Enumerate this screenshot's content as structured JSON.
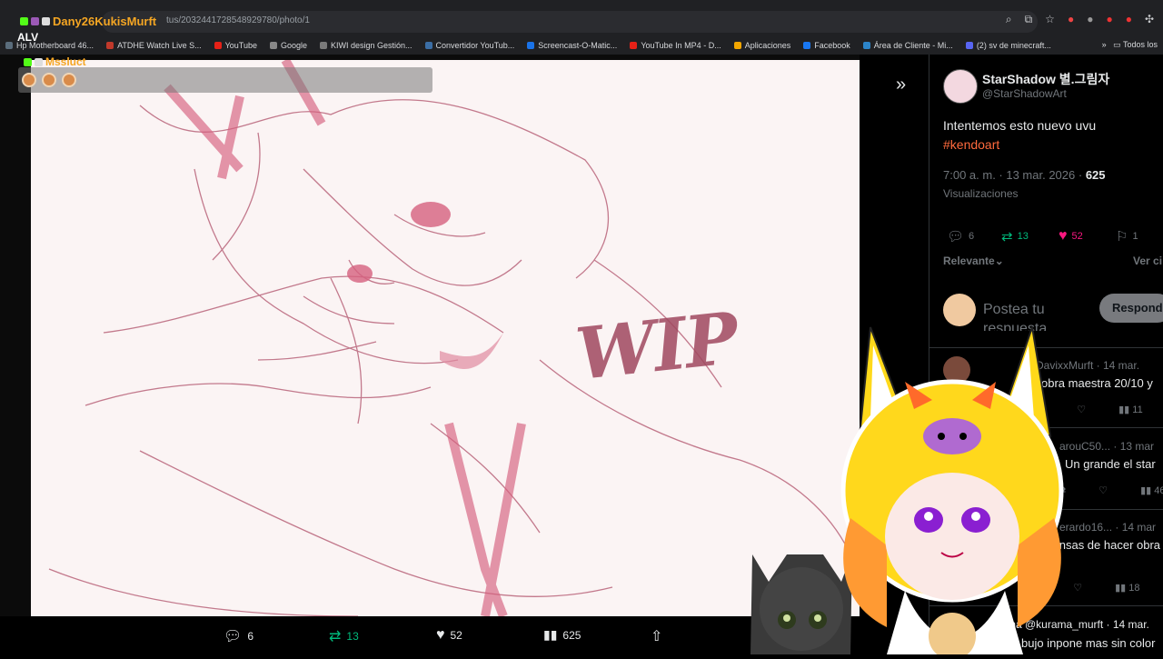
{
  "browser": {
    "url": "tus/2032441728548929780/photo/1",
    "bookmarks": [
      {
        "label": "Hp Motherboard 46...",
        "color": "#5a6d7c"
      },
      {
        "label": "ATDHE Watch Live S...",
        "color": "#c0392b"
      },
      {
        "label": "YouTube",
        "color": "#e62117"
      },
      {
        "label": "Google",
        "color": "#888888"
      },
      {
        "label": "KIWI design Gestión...",
        "color": "#7a7a7a"
      },
      {
        "label": "Convertidor YouTub...",
        "color": "#3b6ea5"
      },
      {
        "label": "Screencast-O-Matic...",
        "color": "#1a73e8"
      },
      {
        "label": "YouTube In MP4 - D...",
        "color": "#e62117"
      },
      {
        "label": "Aplicaciones",
        "color": "#f2a600"
      },
      {
        "label": "Facebook",
        "color": "#1877f2"
      },
      {
        "label": "Área de Cliente - Mi...",
        "color": "#2c84c8"
      },
      {
        "label": "(2) sv de minecraft...",
        "color": "#5865f2"
      }
    ],
    "bookmarks_more": "»",
    "bookmarks_all": "Todos los"
  },
  "chat": {
    "user1": "Dany26KukisMurft",
    "message1": "ALV",
    "user2": "Mssluct"
  },
  "action_bar": {
    "replies": "6",
    "reposts": "13",
    "likes": "52",
    "views": "625"
  },
  "tweet": {
    "author_name": "StarShadow 별.그림자",
    "author_handle": "@StarShadowArt",
    "text": "Intentemos esto nuevo  uvu",
    "hashtag": "#kendoart",
    "time": "7:00 a. m. · 13 mar. 2026 · ",
    "views_count": "625",
    "views_label": "Visualizaciones",
    "stats": {
      "replies": "6",
      "reposts": "13",
      "likes": "52",
      "bookmarks": "1"
    },
    "sort_label": "Relevante",
    "ver_citas": "Ver ci",
    "reply_placeholder": "Postea tu respuesta",
    "reply_button": "Respond"
  },
  "comments": [
    {
      "head": "DavixxMurft · 14 mar.",
      "text": "obra maestra 20/10 y",
      "views": "11"
    },
    {
      "head": "arouC50... · 13 mar",
      "text": "Un grande el star",
      "views": "46"
    },
    {
      "head": "erardo16... · 14 mar",
      "text": "cansas de hacer obra",
      "views": "18"
    },
    {
      "head": "ma @kurama_murft · 14 mar.",
      "text": "bujo inpone mas sin color",
      "views": ""
    }
  ],
  "artwork": {
    "wip_text": "WIP",
    "colors": {
      "line": "#b0506a",
      "paper": "#fbf4f4",
      "accent": "#d6607e"
    }
  },
  "colors": {
    "hashtag": "#ff6a3d",
    "like": "#f91880",
    "repost": "#00ba7c",
    "chat_name": "#f5a623"
  }
}
